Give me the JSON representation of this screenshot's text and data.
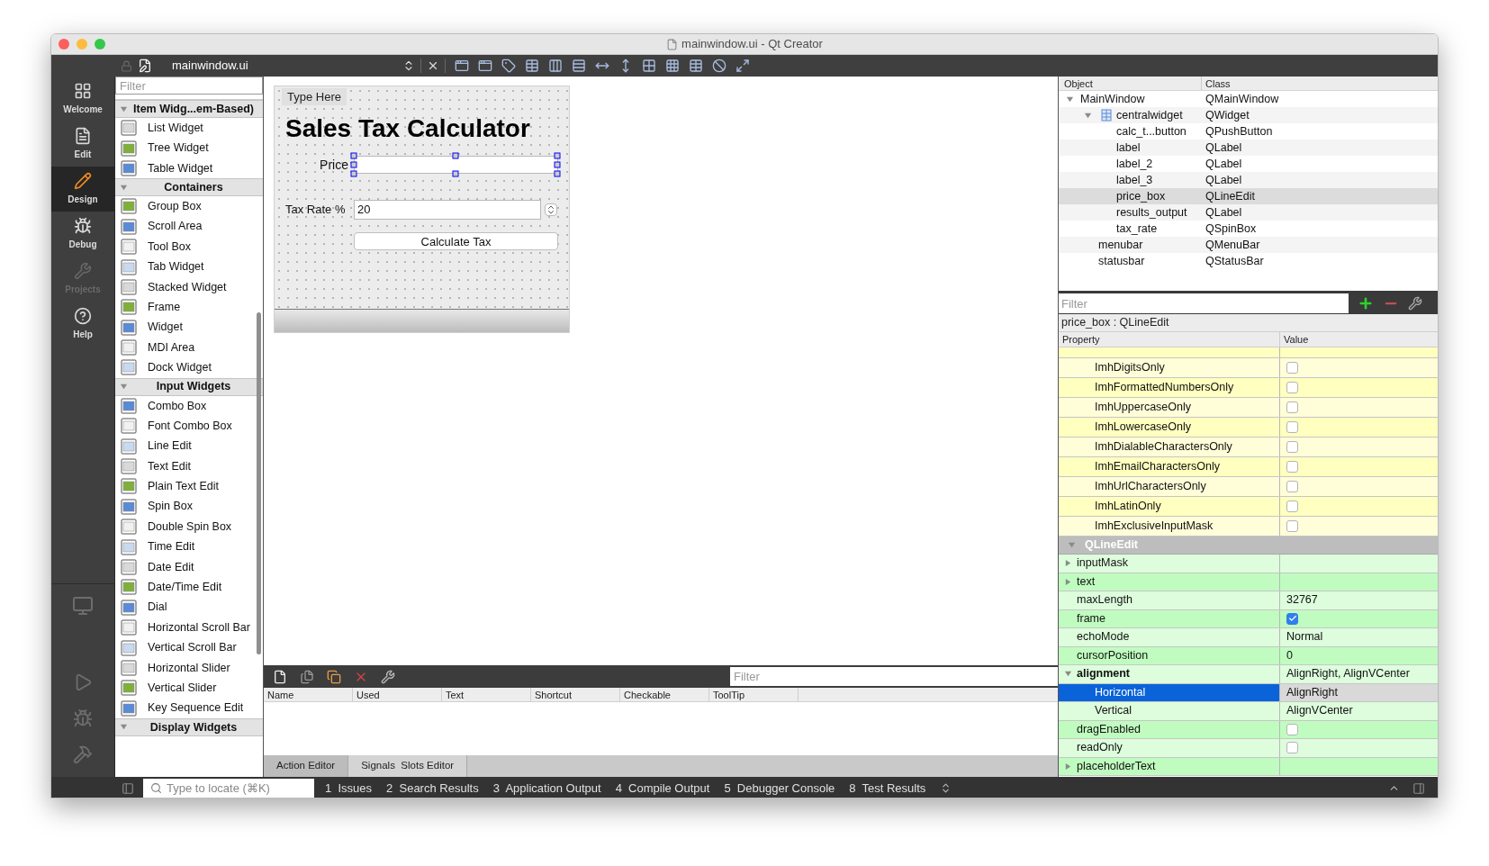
{
  "window": {
    "title": "mainwindow.ui - Qt Creator"
  },
  "modes": [
    {
      "label": "Welcome",
      "selected": false,
      "disabled": false
    },
    {
      "label": "Edit",
      "selected": false,
      "disabled": false
    },
    {
      "label": "Design",
      "selected": true,
      "disabled": false
    },
    {
      "label": "Debug",
      "selected": false,
      "disabled": false
    },
    {
      "label": "Projects",
      "selected": false,
      "disabled": true
    },
    {
      "label": "Help",
      "selected": false,
      "disabled": false
    }
  ],
  "editor_toolbar": {
    "file": "mainwindow.ui"
  },
  "widget_box": {
    "filter_placeholder": "Filter",
    "groups": [
      {
        "title": "Item Widg...em-Based)",
        "expanded": true,
        "items": [
          "List Widget",
          "Tree Widget",
          "Table Widget"
        ]
      },
      {
        "title": "Containers",
        "expanded": true,
        "items": [
          "Group Box",
          "Scroll Area",
          "Tool Box",
          "Tab Widget",
          "Stacked Widget",
          "Frame",
          "Widget",
          "MDI Area",
          "Dock Widget"
        ]
      },
      {
        "title": "Input Widgets",
        "expanded": true,
        "items": [
          "Combo Box",
          "Font Combo Box",
          "Line Edit",
          "Text Edit",
          "Plain Text Edit",
          "Spin Box",
          "Double Spin Box",
          "Time Edit",
          "Date Edit",
          "Date/Time Edit",
          "Dial",
          "Horizontal Scroll Bar",
          "Vertical Scroll Bar",
          "Horizontal Slider",
          "Vertical Slider",
          "Key Sequence Edit"
        ]
      },
      {
        "title": "Display Widgets",
        "expanded": true
      }
    ]
  },
  "form": {
    "menu_placeholder": "Type Here",
    "title": "Sales Tax Calculator",
    "price_label": "Price",
    "tax_label": "Tax Rate %",
    "tax_value": "20",
    "button": "Calculate Tax"
  },
  "action_editor": {
    "filter_placeholder": "Filter",
    "columns": [
      "Name",
      "Used",
      "Text",
      "Shortcut",
      "Checkable",
      "ToolTip"
    ],
    "tabs": [
      {
        "label": "Action Editor",
        "selected": true
      },
      {
        "label": "Signals  Slots Editor",
        "selected": false
      }
    ]
  },
  "object_inspector": {
    "columns": [
      "Object",
      "Class"
    ],
    "tree": [
      {
        "object": "MainWindow",
        "class": "QMainWindow",
        "selected": false,
        "expanded": true,
        "children": [
          {
            "object": "centralwidget",
            "class": "QWidget",
            "selected": false,
            "expanded": true,
            "children": [
              {
                "object": "calc_t...button",
                "class": "QPushButton",
                "selected": false
              },
              {
                "object": "label",
                "class": "QLabel",
                "selected": false
              },
              {
                "object": "label_2",
                "class": "QLabel",
                "selected": false
              },
              {
                "object": "label_3",
                "class": "QLabel",
                "selected": false
              },
              {
                "object": "price_box",
                "class": "QLineEdit",
                "selected": true
              },
              {
                "object": "results_output",
                "class": "QLabel",
                "selected": false
              },
              {
                "object": "tax_rate",
                "class": "QSpinBox",
                "selected": false
              }
            ]
          },
          {
            "object": "menubar",
            "class": "QMenuBar",
            "selected": false
          },
          {
            "object": "statusbar",
            "class": "QStatusBar",
            "selected": false
          }
        ]
      }
    ]
  },
  "property_editor": {
    "filter_placeholder": "Filter",
    "object_label": "price_box : QLineEdit",
    "columns": [
      "Property",
      "Value"
    ],
    "rows": [
      {
        "kind": "flag",
        "name": "ImhDigitsOnly",
        "checked": false
      },
      {
        "kind": "flag",
        "name": "ImhFormattedNumbersOnly",
        "checked": false
      },
      {
        "kind": "flag",
        "name": "ImhUppercaseOnly",
        "checked": false
      },
      {
        "kind": "flag",
        "name": "ImhLowercaseOnly",
        "checked": false
      },
      {
        "kind": "flag",
        "name": "ImhDialableCharactersOnly",
        "checked": false
      },
      {
        "kind": "flag",
        "name": "ImhEmailCharactersOnly",
        "checked": false
      },
      {
        "kind": "flag",
        "name": "ImhUrlCharactersOnly",
        "checked": false
      },
      {
        "kind": "flag",
        "name": "ImhLatinOnly",
        "checked": false
      },
      {
        "kind": "flag",
        "name": "ImhExclusiveInputMask",
        "checked": false
      },
      {
        "kind": "section",
        "name": "QLineEdit",
        "expanded": true
      },
      {
        "kind": "text",
        "name": "inputMask",
        "expanded": false,
        "modified": false,
        "selected": false
      },
      {
        "kind": "text",
        "name": "text",
        "expanded": false,
        "modified": false,
        "selected": false
      },
      {
        "kind": "text",
        "name": "maxLength",
        "value": "32767",
        "modified": false,
        "selected": false
      },
      {
        "kind": "checkbox",
        "name": "frame",
        "checked": true,
        "modified": false,
        "selected": false
      },
      {
        "kind": "text",
        "name": "echoMode",
        "value": "Normal",
        "modified": false,
        "selected": false
      },
      {
        "kind": "text",
        "name": "cursorPosition",
        "value": "0",
        "modified": false,
        "selected": false
      },
      {
        "kind": "text",
        "name": "alignment",
        "value": "AlignRight, AlignVCenter",
        "expanded": true,
        "modified": true,
        "selected": false,
        "children": [
          {
            "kind": "text",
            "name": "Horizontal",
            "value": "AlignRight",
            "modified": false,
            "selected": true
          },
          {
            "kind": "text",
            "name": "Vertical",
            "value": "AlignVCenter",
            "modified": false,
            "selected": false
          }
        ]
      },
      {
        "kind": "checkbox",
        "name": "dragEnabled",
        "checked": false,
        "modified": false,
        "selected": false
      },
      {
        "kind": "checkbox",
        "name": "readOnly",
        "checked": false,
        "modified": false,
        "selected": false
      },
      {
        "kind": "text",
        "name": "placeholderText",
        "expanded": false,
        "modified": false,
        "selected": false
      }
    ]
  },
  "status_bar": {
    "locate_placeholder": "Type to locate (⌘K)",
    "panes": [
      {
        "number": "1",
        "label": "Issues"
      },
      {
        "number": "2",
        "label": "Search Results"
      },
      {
        "number": "3",
        "label": "Application Output"
      },
      {
        "number": "4",
        "label": "Compile Output"
      },
      {
        "number": "5",
        "label": "Debugger Console"
      },
      {
        "number": "8",
        "label": "Test Results"
      }
    ]
  }
}
